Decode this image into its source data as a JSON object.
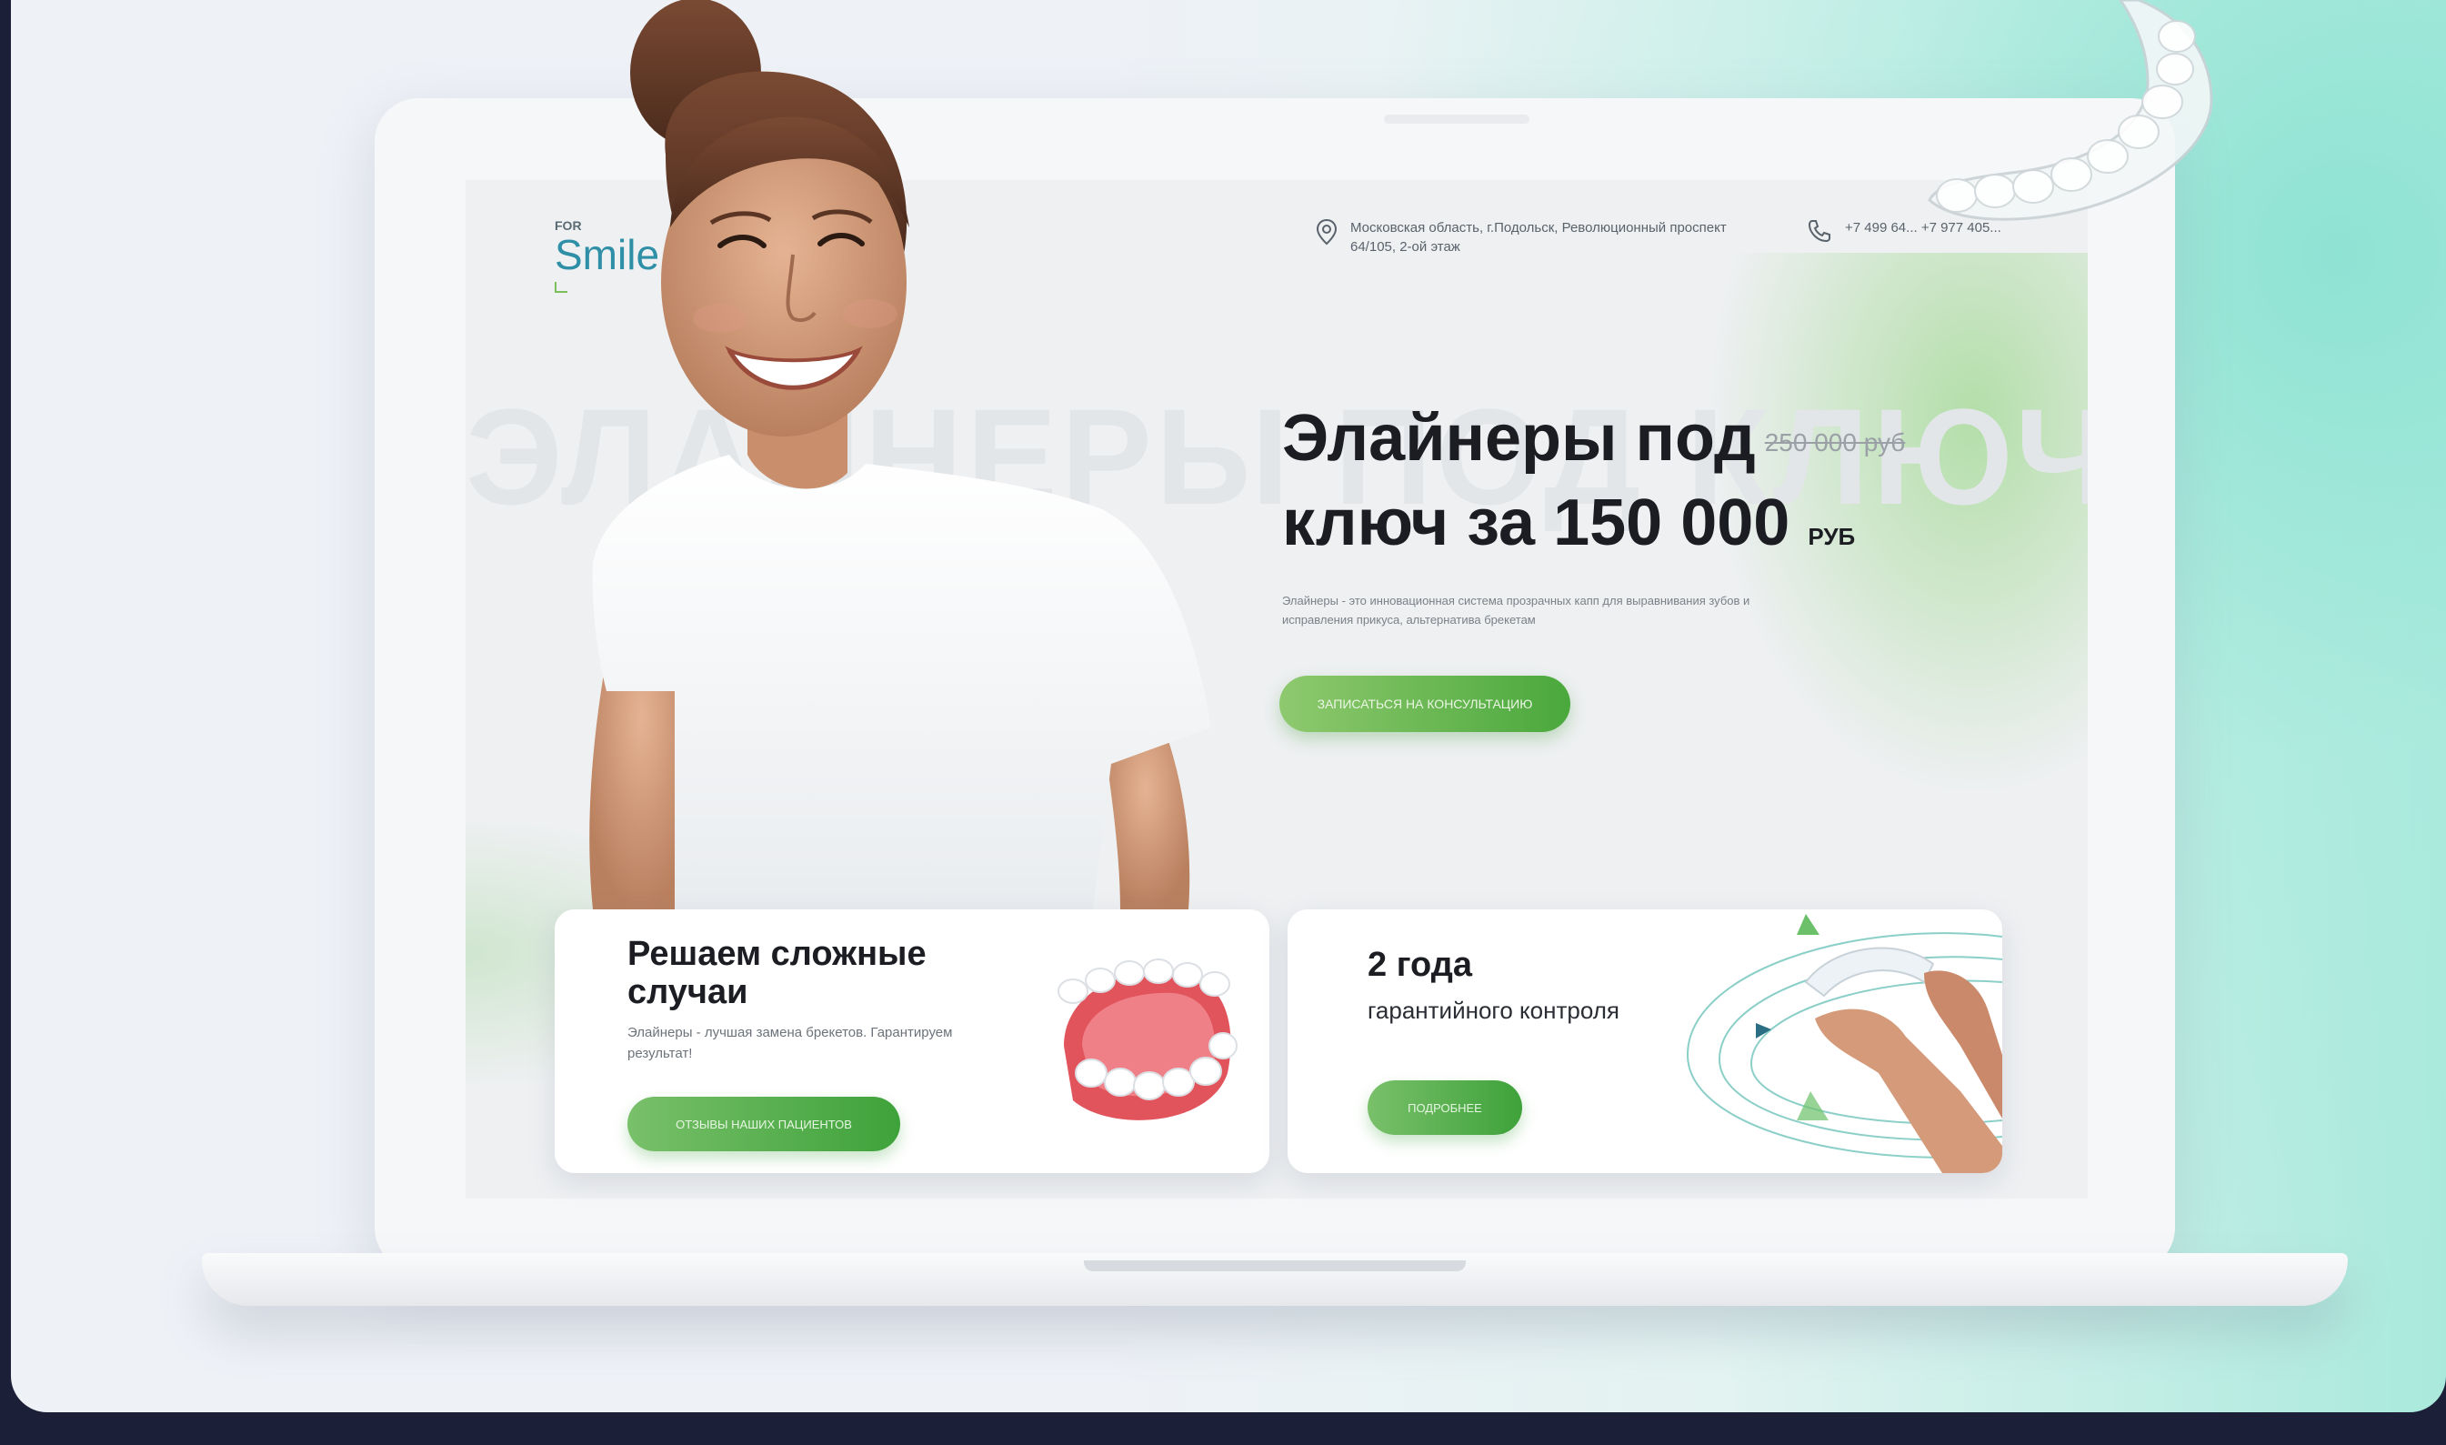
{
  "header": {
    "logo_top": "FOR",
    "logo_main": "Smile",
    "address": "Московская область, г.Подольск, Революционный проспект 64/105, 2-ой этаж",
    "phone": "+7 499 64... +7 977 405..."
  },
  "hero": {
    "background_word": "ЭЛАЙНЕРЫ ПОД КЛЮЧ",
    "title_line1": "Элайнеры под",
    "old_price": "250 000 руб",
    "title_line2": "ключ за 150 000",
    "currency": "РУБ",
    "description": "Элайнеры - это инновационная система прозрачных капп для выравнивания зубов и исправления прикуса, альтернатива брекетам",
    "cta_label": "ЗАПИСАТЬСЯ НА КОНСУЛЬТАЦИЮ"
  },
  "cards": [
    {
      "title": "Решаем сложные случаи",
      "subtitle": "Элайнеры - лучшая замена брекетов. Гарантируем результат!",
      "button": "ОТЗЫВЫ НАШИХ ПАЦИЕНТОВ"
    },
    {
      "title": "2 года",
      "subtitle": "гарантийного контроля",
      "button": "ПОДРОБНЕЕ"
    }
  ],
  "colors": {
    "accent_green": "#4aa83c",
    "logo_teal": "#2f8fa6",
    "page_bg": "#1c1f38"
  }
}
